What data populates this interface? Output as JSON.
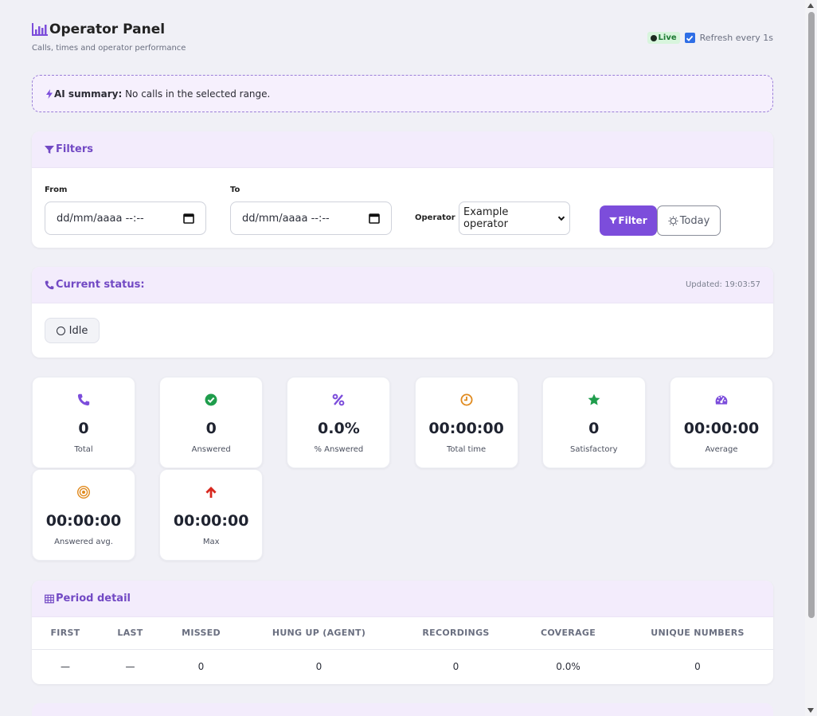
{
  "header": {
    "title": "Operator Panel",
    "subtitle": "Calls, times and operator performance",
    "live_label": "Live",
    "refresh_label": "Refresh every 1s",
    "refresh_checked": true
  },
  "ai_summary": {
    "prefix": "AI summary:",
    "text": " No calls in the selected range."
  },
  "filters": {
    "title": "Filters",
    "from_label": "From",
    "from_placeholder": "dd/mm/aaaa --:--",
    "to_label": "To",
    "to_placeholder": "dd/mm/aaaa --:--",
    "operator_label": "Operator",
    "operator_value": "Example operator",
    "filter_button": "Filter",
    "today_button": "Today"
  },
  "status": {
    "title": "Current status:",
    "updated": "Updated: 19:03:57",
    "state": "Idle"
  },
  "stats": [
    {
      "icon": "phone-icon",
      "value": "0",
      "label": "Total",
      "color": "#7c4ddb"
    },
    {
      "icon": "check-circle-icon",
      "value": "0",
      "label": "Answered",
      "color": "#1f9d4c"
    },
    {
      "icon": "percent-icon",
      "value": "0.0%",
      "label": "% Answered",
      "color": "#7c4ddb"
    },
    {
      "icon": "clock-icon",
      "value": "00:00:00",
      "label": "Total time",
      "color": "#e08a1e"
    },
    {
      "icon": "star-icon",
      "value": "0",
      "label": "Satisfactory",
      "color": "#1f9d4c"
    },
    {
      "icon": "gauge-icon",
      "value": "00:00:00",
      "label": "Average",
      "color": "#7c4ddb"
    },
    {
      "icon": "target-icon",
      "value": "00:00:00",
      "label": "Answered avg.",
      "color": "#e08a1e"
    },
    {
      "icon": "arrow-up-icon",
      "value": "00:00:00",
      "label": "Max",
      "color": "#d8281f"
    }
  ],
  "period": {
    "title": "Period detail",
    "columns": [
      "FIRST",
      "LAST",
      "MISSED",
      "HUNG UP (AGENT)",
      "RECORDINGS",
      "COVERAGE",
      "UNIQUE NUMBERS"
    ],
    "row": [
      "—",
      "—",
      "0",
      "0",
      "0",
      "0.0%",
      "0"
    ]
  },
  "colors": {
    "accent": "#7c4ddb",
    "background": "#f0f0f6"
  }
}
